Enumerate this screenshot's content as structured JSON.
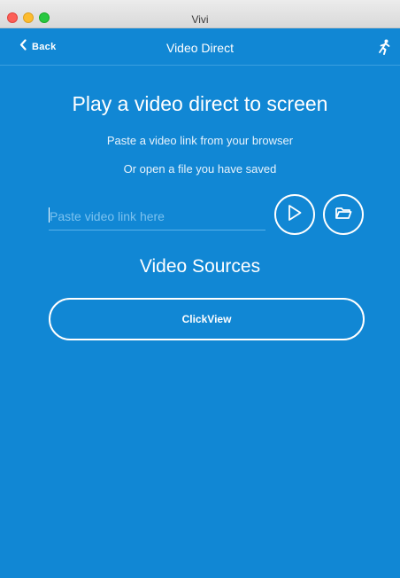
{
  "window": {
    "title": "Vivi"
  },
  "nav": {
    "back_label": "Back",
    "title": "Video Direct",
    "runner_icon": "running-person-icon"
  },
  "main": {
    "headline": "Play a video direct to screen",
    "line1": "Paste a video link from your browser",
    "line2": "Or open a file you have saved",
    "link_input": {
      "placeholder": "Paste video link here",
      "value": ""
    },
    "play_icon": "play-icon",
    "folder_icon": "folder-open-icon",
    "sources_title": "Video Sources",
    "sources": [
      {
        "label": "ClickView"
      }
    ]
  },
  "colors": {
    "background": "#1187d4",
    "foreground": "#ffffff"
  }
}
